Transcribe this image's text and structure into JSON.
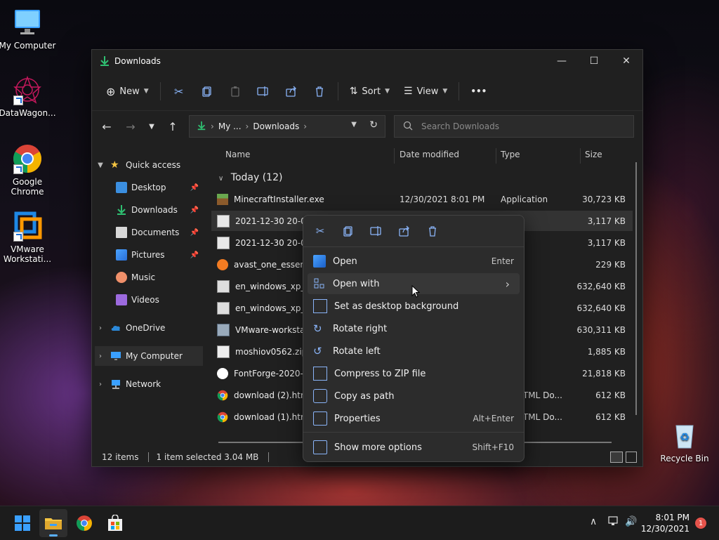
{
  "desktop": {
    "icons": [
      {
        "label": "My Computer"
      },
      {
        "label": "DataWagon..."
      },
      {
        "label": "Google Chrome"
      },
      {
        "label": "VMware Workstati..."
      },
      {
        "label": "Recycle Bin"
      }
    ]
  },
  "window": {
    "title": "Downloads",
    "toolbar": {
      "new_label": "New",
      "sort_label": "Sort",
      "view_label": "View",
      "more_label": "•••"
    },
    "address": {
      "crumbs": [
        "My ...",
        "Downloads"
      ]
    },
    "search": {
      "placeholder": "Search Downloads"
    },
    "sidebar": {
      "items": [
        {
          "label": "Quick access"
        },
        {
          "label": "Desktop"
        },
        {
          "label": "Downloads"
        },
        {
          "label": "Documents"
        },
        {
          "label": "Pictures"
        },
        {
          "label": "Music"
        },
        {
          "label": "Videos"
        },
        {
          "label": "OneDrive"
        },
        {
          "label": "My Computer"
        },
        {
          "label": "Network"
        }
      ]
    },
    "columns": {
      "name": "Name",
      "date": "Date modified",
      "type": "Type",
      "size": "Size"
    },
    "group": "Today (12)",
    "files": [
      {
        "name": "MinecraftInstaller.exe",
        "date": "12/30/2021 8:01 PM",
        "type": "Application",
        "size": "30,723 KB"
      },
      {
        "name": "2021-12-30 20-01-18",
        "date": "",
        "type": "ile",
        "size": "3,117 KB"
      },
      {
        "name": "2021-12-30 20-01-18",
        "date": "",
        "type": "ile",
        "size": "3,117 KB"
      },
      {
        "name": "avast_one_essential",
        "date": "",
        "type": "ation",
        "size": "229 KB"
      },
      {
        "name": "en_windows_xp_pro",
        "date": "",
        "type": "chive",
        "size": "632,640 KB"
      },
      {
        "name": "en_windows_xp_pro",
        "date": "",
        "type": "chive",
        "size": "632,640 KB"
      },
      {
        "name": "VMware-workstation",
        "date": "",
        "type": "ation",
        "size": "630,311 KB"
      },
      {
        "name": "moshiov0562.zip",
        "date": "",
        "type": "chive",
        "size": "1,885 KB"
      },
      {
        "name": "FontForge-2020-11-",
        "date": "",
        "type": "ation",
        "size": "21,818 KB"
      },
      {
        "name": "download (2).htm",
        "date": "",
        "type": "me HTML Do...",
        "size": "612 KB"
      },
      {
        "name": "download (1).htm",
        "date": "",
        "type": "me HTML Do...",
        "size": "612 KB"
      }
    ],
    "status": {
      "items": "12 items",
      "selected": "1 item selected  3.04 MB"
    }
  },
  "context_menu": {
    "items": [
      {
        "label": "Open",
        "accel": "Enter"
      },
      {
        "label": "Open with",
        "accel": "›"
      },
      {
        "label": "Set as desktop background",
        "accel": ""
      },
      {
        "label": "Rotate right",
        "accel": ""
      },
      {
        "label": "Rotate left",
        "accel": ""
      },
      {
        "label": "Compress to ZIP file",
        "accel": ""
      },
      {
        "label": "Copy as path",
        "accel": ""
      },
      {
        "label": "Properties",
        "accel": "Alt+Enter"
      },
      {
        "label": "Show more options",
        "accel": "Shift+F10"
      }
    ]
  },
  "taskbar": {
    "time": "8:01 PM",
    "date": "12/30/2021",
    "notifications": "1"
  },
  "colors": {
    "accent": "#5ab0ff",
    "folder": "#f5c542",
    "download_green": "#2fbf71"
  }
}
